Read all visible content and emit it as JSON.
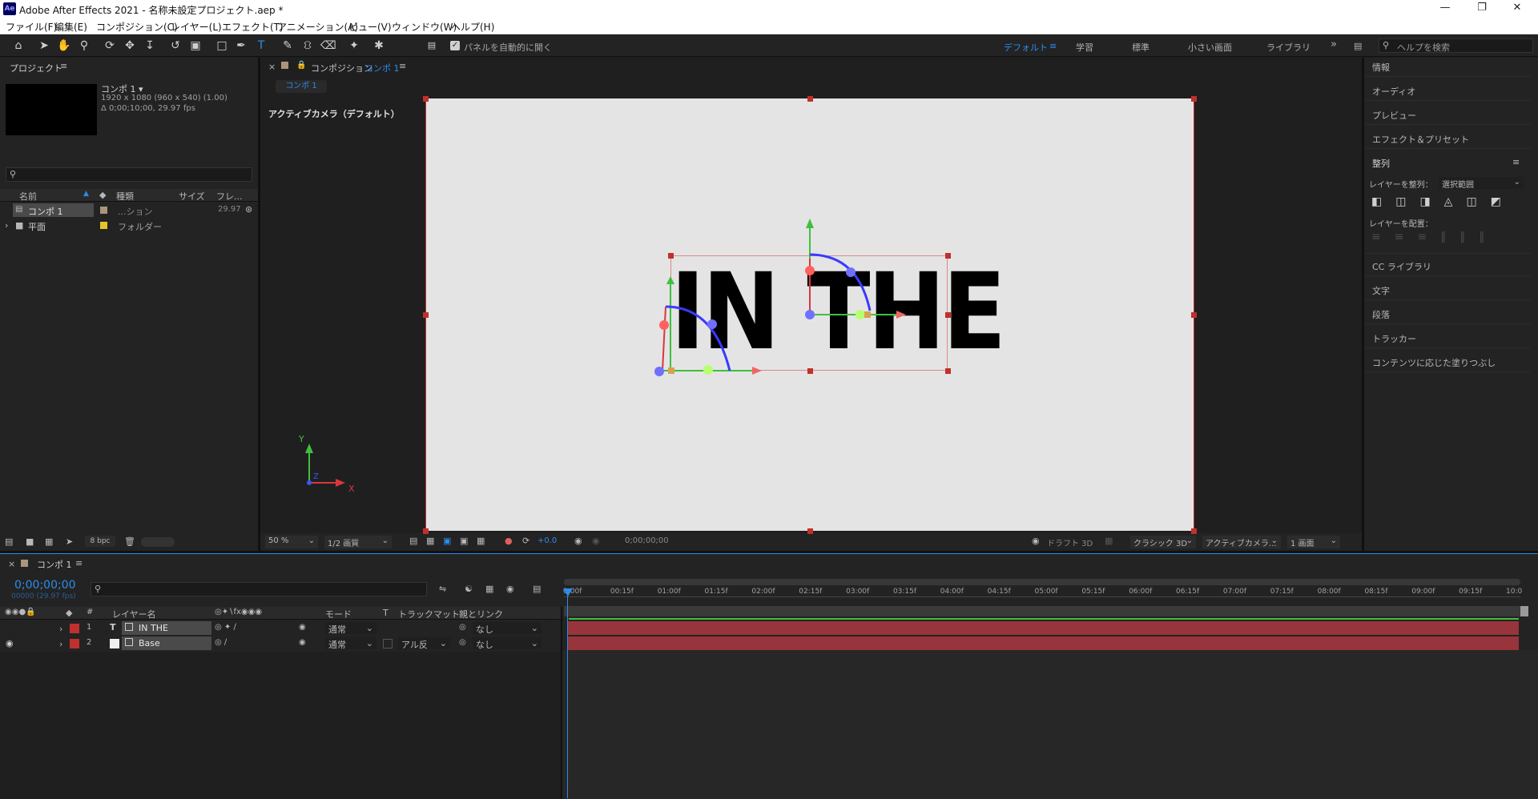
{
  "window": {
    "title": "Adobe After Effects 2021 - 名称未設定プロジェクト.aep *",
    "logo_text": "Ae"
  },
  "menu": [
    "ファイル(F)",
    "編集(E)",
    "コンポジション(C)",
    "レイヤー(L)",
    "エフェクト(T)",
    "アニメーション(A)",
    "ビュー(V)",
    "ウィンドウ(W)",
    "ヘルプ(H)"
  ],
  "toolbar": {
    "auto_open_label": "パネルを自動的に開く",
    "workspaces": [
      "デフォルト",
      "学習",
      "標準",
      "小さい画面",
      "ライブラリ"
    ],
    "help_search_placeholder": "ヘルプを検索"
  },
  "project_panel": {
    "title": "プロジェクト",
    "comp_name": "コンポ 1 ▾",
    "comp_info_1": "1920 x 1080  (960 x 540) (1.00)",
    "comp_info_2": "Δ 0;00;10;00, 29.97 fps",
    "columns": [
      "名前",
      "種類",
      "サイズ",
      "フレ..."
    ],
    "items": [
      {
        "name": "コンポ 1",
        "type": "...ション",
        "fps": "29.97",
        "color": "#a9957b"
      },
      {
        "name": "平面",
        "type": "フォルダー",
        "fps": "",
        "color": "#e6c429"
      }
    ],
    "bpc": "8 bpc"
  },
  "comp_panel": {
    "title_prefix": "コンポジション",
    "title_comp": "コンポ 1",
    "tab": "コンポ 1",
    "camera_label": "アクティブカメラ（デフォルト）",
    "canvas_text": "IN THE",
    "zoom": "50 %",
    "resolution": "1/2 画質",
    "exposure": "+0.0",
    "timecode": "0;00;00;00",
    "draft3d": "ドラフト 3D",
    "renderer": "クラシック 3D",
    "camera_select": "アクティブカメラ...",
    "views": "1 画面",
    "axis_x": "X",
    "axis_y": "Y",
    "axis_z": "Z"
  },
  "right_panel": {
    "items_top": [
      "情報",
      "オーディオ",
      "プレビュー",
      "エフェクト＆プリセット"
    ],
    "align_title": "整列",
    "align_to_label": "レイヤーを整列：",
    "align_to_value": "選択範囲",
    "distribute_label": "レイヤーを配置：",
    "items_bottom": [
      "CC ライブラリ",
      "文字",
      "段落",
      "トラッカー",
      "コンテンツに応じた塗りつぶし"
    ]
  },
  "timeline": {
    "tab": "コンポ 1",
    "timecode": "0;00;00;00",
    "frame_info": "00000 (29.97 fps)",
    "columns": {
      "layer_name": "レイヤー名",
      "mode": "モード",
      "t": "T",
      "trackmatte": "トラックマット",
      "parent": "親とリンク"
    },
    "layers": [
      {
        "num": "1",
        "type_icon": "T",
        "name": "IN THE",
        "mode": "通常",
        "trackmatte": "",
        "parent": "なし",
        "label_color": "#c0302d",
        "eye": false
      },
      {
        "num": "2",
        "type_icon": "",
        "name": "Base",
        "mode": "通常",
        "trackmatte": "アル反",
        "parent": "なし",
        "label_color": "#c0302d",
        "eye": true
      }
    ],
    "ruler_ticks": [
      "0:00f",
      "00:15f",
      "01:00f",
      "01:15f",
      "02:00f",
      "02:15f",
      "03:00f",
      "03:15f",
      "04:00f",
      "04:15f",
      "05:00f",
      "05:15f",
      "06:00f",
      "06:15f",
      "07:00f",
      "07:15f",
      "08:00f",
      "08:15f",
      "09:00f",
      "09:15f",
      "10:0"
    ]
  },
  "colors": {
    "accent": "#2d8ceb",
    "layer_bar": "#a13a42",
    "label_red": "#c0302d",
    "canvas_bg": "#e4e4e4"
  }
}
